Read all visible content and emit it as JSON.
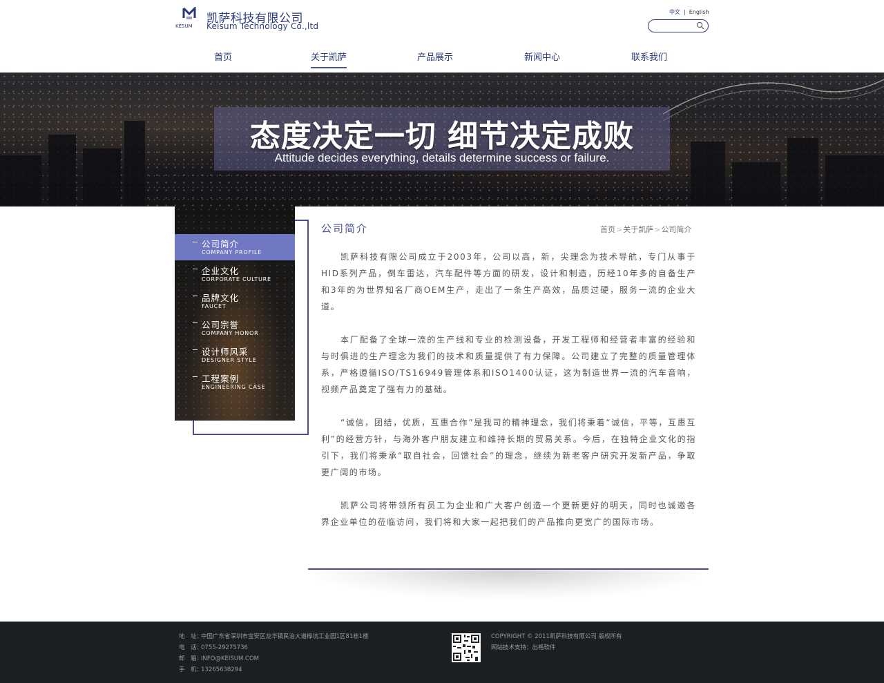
{
  "header": {
    "logo_badge": "KESUM",
    "company_cn": "凯萨科技有限公司",
    "company_en": "Keisum Technology Co.,ltd",
    "lang_cn": "中文",
    "lang_sep": "|",
    "lang_en": "English",
    "search_placeholder": ""
  },
  "nav": {
    "items": [
      {
        "label": "首页"
      },
      {
        "label": "关于凯萨"
      },
      {
        "label": "产品展示"
      },
      {
        "label": "新闻中心"
      },
      {
        "label": "联系我们"
      }
    ],
    "active_index": 1
  },
  "banner": {
    "title": "态度决定一切 细节决定成败",
    "subtitle": "Attitude decides everything, details determine success or failure."
  },
  "sidebar": {
    "items": [
      {
        "cn": "公司简介",
        "en": "COMPANY PROFILE"
      },
      {
        "cn": "企业文化",
        "en": "CORPORATE CULTURE"
      },
      {
        "cn": "品牌文化",
        "en": "FAUCET"
      },
      {
        "cn": "公司宗誉",
        "en": "COMPANY HONOR"
      },
      {
        "cn": "设计师风采",
        "en": "DESIGNER STYLE"
      },
      {
        "cn": "工程案例",
        "en": "ENGINEERING CASE"
      }
    ],
    "active_index": 0
  },
  "content": {
    "title": "公司简介",
    "breadcrumb": [
      "首页",
      "关于凯萨",
      "公司简介"
    ],
    "breadcrumb_sep": ">",
    "paragraphs": [
      "凯萨科技有限公司成立于2003年，公司以高，新，尖理念为技术导航，专门从事于HID系列产品，倒车雷达，汽车配件等方面的研发，设计和制造，历经10年多的自备生产和3年的为世界知名厂商OEM生产，走出了一条生产高效，品质过硬，服务一流的企业大道。",
      "本厂配备了全球一流的生产线和专业的检测设备，开发工程师和经营者丰富的经验和与时俱进的生产理念为我们的技术和质量提供了有力保障。公司建立了完整的质量管理体系，严格遵循ISO/TS16949管理体系和ISO1400认证，这为制造世界一流的汽车音响，视频产品奠定了强有力的基础。",
      "“诚信，团结，优质，互惠合作”是我司的精神理念，我们将秉着“诚信，平等，互惠互利”的经营方针，与海外客户朋友建立和维持长期的贸易关系。今后，在独特企业文化的指引下，我们将秉承“取自社会，回馈社会”的理念，继续为新老客户研究开发新产品，争取更广阔的市场。",
      "凯萨公司将带领所有员工为企业和广大客户创造一个更新更好的明天，同时也诚邀各界企业单位的莅临访问，我们将和大家一起把我们的产品推向更宽广的国际市场。"
    ]
  },
  "footer": {
    "address_label": "地　址：",
    "address": "中国广东省深圳市宝安区龙华镇民治大道樟坑工业园1区81栋1楼",
    "phone_label": "电　话：",
    "phone": "0755-29275736",
    "email_label": "邮　箱：",
    "email": "INFO@KEISUM.COM",
    "mobile_label": "手　机：",
    "mobile": "13265638294",
    "copyright": "COPYRIGHT © 2011凯萨科技有限公司 版权所有",
    "support": "网站技术支持：出格软件"
  },
  "colors": {
    "brand": "#2b3a7a",
    "accent": "#7078c4",
    "footer_bg": "#1c1f22"
  }
}
